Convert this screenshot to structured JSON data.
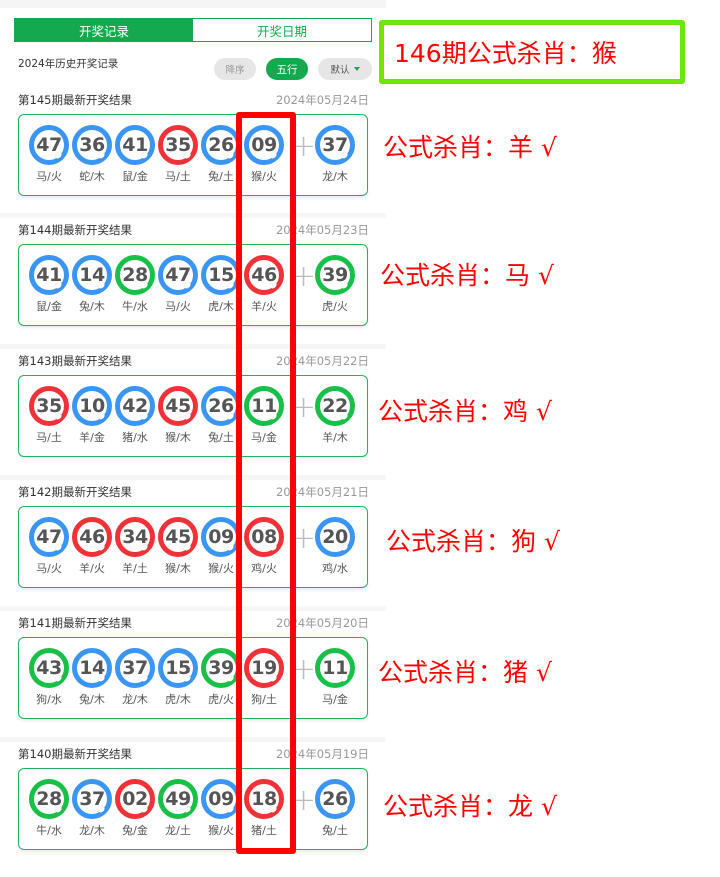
{
  "tabs": [
    {
      "label": "开奖记录",
      "active": true
    },
    {
      "label": "开奖日期",
      "active": false
    }
  ],
  "subheader": {
    "title": "2024年历史开奖记录",
    "sort_label": "降序",
    "wuxing_label": "五行",
    "default_label": "默认"
  },
  "colors": {
    "brand_green": "#14a94f",
    "ball_blue": "#3a95f3",
    "ball_red": "#f03238",
    "ball_green": "#18c048",
    "annotation_red": "#ff0000",
    "highlight_green": "#6ee60a"
  },
  "headline": "146期公式杀肖：猴",
  "records": [
    {
      "title": "第145期最新开奖结果",
      "date": "2024年05月24日",
      "balls": [
        {
          "num": "47",
          "color": "blue",
          "label": "马/火"
        },
        {
          "num": "36",
          "color": "blue",
          "label": "蛇/木"
        },
        {
          "num": "41",
          "color": "blue",
          "label": "鼠/金"
        },
        {
          "num": "35",
          "color": "red",
          "label": "马/土"
        },
        {
          "num": "26",
          "color": "blue",
          "label": "兔/土"
        },
        {
          "num": "09",
          "color": "blue",
          "label": "猴/火"
        }
      ],
      "special": {
        "num": "37",
        "color": "blue",
        "label": "龙/木"
      },
      "annotation": "公式杀肖：羊 √"
    },
    {
      "title": "第144期最新开奖结果",
      "date": "2024年05月23日",
      "balls": [
        {
          "num": "41",
          "color": "blue",
          "label": "鼠/金"
        },
        {
          "num": "14",
          "color": "blue",
          "label": "兔/木"
        },
        {
          "num": "28",
          "color": "green",
          "label": "牛/水"
        },
        {
          "num": "47",
          "color": "blue",
          "label": "马/火"
        },
        {
          "num": "15",
          "color": "blue",
          "label": "虎/木"
        },
        {
          "num": "46",
          "color": "red",
          "label": "羊/火"
        }
      ],
      "special": {
        "num": "39",
        "color": "green",
        "label": "虎/火"
      },
      "annotation": "公式杀肖：马 √"
    },
    {
      "title": "第143期最新开奖结果",
      "date": "2024年05月22日",
      "balls": [
        {
          "num": "35",
          "color": "red",
          "label": "马/土"
        },
        {
          "num": "10",
          "color": "blue",
          "label": "羊/金"
        },
        {
          "num": "42",
          "color": "blue",
          "label": "猪/水"
        },
        {
          "num": "45",
          "color": "red",
          "label": "猴/木"
        },
        {
          "num": "26",
          "color": "blue",
          "label": "兔/土"
        },
        {
          "num": "11",
          "color": "green",
          "label": "马/金"
        }
      ],
      "special": {
        "num": "22",
        "color": "green",
        "label": "羊/木"
      },
      "annotation": "公式杀肖：鸡 √"
    },
    {
      "title": "第142期最新开奖结果",
      "date": "2024年05月21日",
      "balls": [
        {
          "num": "47",
          "color": "blue",
          "label": "马/火"
        },
        {
          "num": "46",
          "color": "red",
          "label": "羊/火"
        },
        {
          "num": "34",
          "color": "red",
          "label": "羊/土"
        },
        {
          "num": "45",
          "color": "red",
          "label": "猴/木"
        },
        {
          "num": "09",
          "color": "blue",
          "label": "猴/火"
        },
        {
          "num": "08",
          "color": "red",
          "label": "鸡/火"
        }
      ],
      "special": {
        "num": "20",
        "color": "blue",
        "label": "鸡/水"
      },
      "annotation": "公式杀肖：狗 √"
    },
    {
      "title": "第141期最新开奖结果",
      "date": "2024年05月20日",
      "balls": [
        {
          "num": "43",
          "color": "green",
          "label": "狗/水"
        },
        {
          "num": "14",
          "color": "blue",
          "label": "兔/木"
        },
        {
          "num": "37",
          "color": "blue",
          "label": "龙/木"
        },
        {
          "num": "15",
          "color": "blue",
          "label": "虎/木"
        },
        {
          "num": "39",
          "color": "green",
          "label": "虎/火"
        },
        {
          "num": "19",
          "color": "red",
          "label": "狗/土"
        }
      ],
      "special": {
        "num": "11",
        "color": "green",
        "label": "马/金"
      },
      "annotation": "公式杀肖：猪 √"
    },
    {
      "title": "第140期最新开奖结果",
      "date": "2024年05月19日",
      "balls": [
        {
          "num": "28",
          "color": "green",
          "label": "牛/水"
        },
        {
          "num": "37",
          "color": "blue",
          "label": "龙/木"
        },
        {
          "num": "02",
          "color": "red",
          "label": "兔/金"
        },
        {
          "num": "49",
          "color": "green",
          "label": "龙/土"
        },
        {
          "num": "09",
          "color": "blue",
          "label": "猴/火"
        },
        {
          "num": "18",
          "color": "red",
          "label": "猪/土"
        }
      ],
      "special": {
        "num": "26",
        "color": "blue",
        "label": "兔/土"
      },
      "annotation": "公式杀肖：龙 √"
    }
  ]
}
